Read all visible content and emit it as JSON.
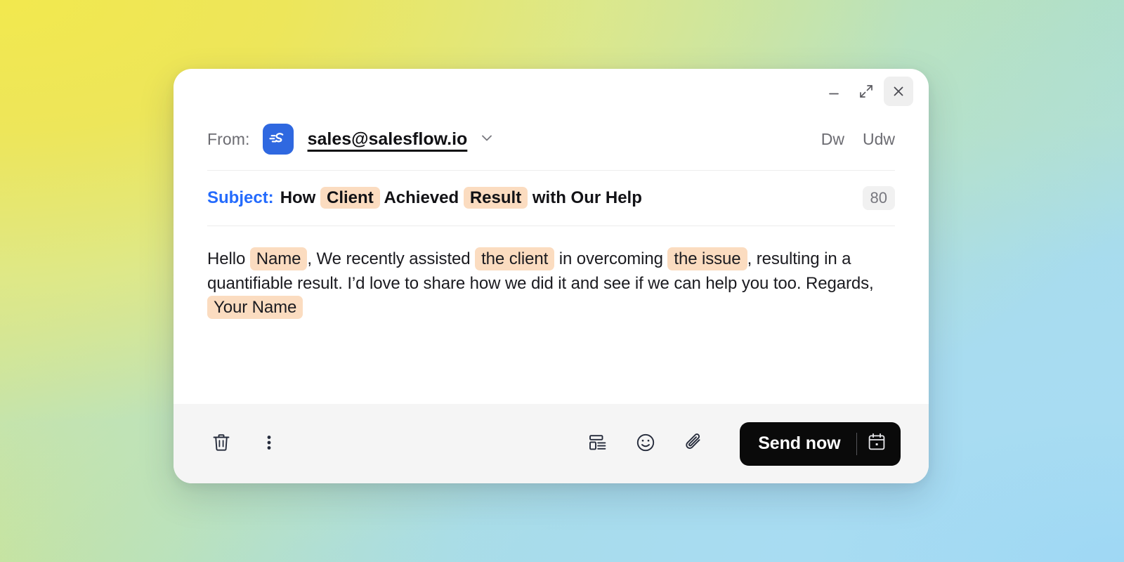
{
  "window": {
    "controls": {
      "minimize_label": "Minimize",
      "expand_label": "Expand",
      "close_label": "Close"
    }
  },
  "from": {
    "label": "From:",
    "address": "sales@salesflow.io",
    "brand_icon": "salesflow-logo-icon",
    "caret_icon": "chevron-down-icon",
    "cc_label": "Dw",
    "bcc_label": "Udw"
  },
  "subject": {
    "label": "Subject:",
    "parts": [
      {
        "type": "text",
        "value": "How "
      },
      {
        "type": "chip",
        "value": "Client"
      },
      {
        "type": "text",
        "value": " Achieved "
      },
      {
        "type": "chip",
        "value": "Result"
      },
      {
        "type": "text",
        "value": " with Our Help"
      }
    ],
    "plain": "How Client Achieved Result with Our Help",
    "char_count": "80"
  },
  "body": {
    "parts": [
      {
        "type": "text",
        "value": "Hello "
      },
      {
        "type": "chip",
        "value": "Name"
      },
      {
        "type": "text",
        "value": ", We recently assisted "
      },
      {
        "type": "chip",
        "value": "the client"
      },
      {
        "type": "text",
        "value": " in overcoming "
      },
      {
        "type": "chip",
        "value": "the issue"
      },
      {
        "type": "text",
        "value": ", resulting in a quantifiable result. I’d love to share how we did it and see if we can help you too. Regards, "
      },
      {
        "type": "chip",
        "value": "Your Name"
      }
    ],
    "plain": "Hello Name, We recently assisted the client in overcoming the issue, resulting in a quantifiable result. I’d love to share how we did it and see if we can help you too. Regards, Your Name"
  },
  "toolbar": {
    "delete_label": "Delete draft",
    "more_label": "More options",
    "template_label": "Insert template",
    "emoji_label": "Insert emoji",
    "attach_label": "Attach file",
    "send_label": "Send now",
    "schedule_label": "Schedule send"
  },
  "colors": {
    "accent_blue": "#246BFD",
    "brand_blue": "#2F68E0",
    "chip_peach": "#FBDCC0",
    "send_black": "#0A0A0A",
    "footer_gray": "#F5F5F5",
    "badge_gray": "#F1F1F1",
    "gradient_start": "#EFE44F",
    "gradient_end": "#A6DCF2"
  }
}
